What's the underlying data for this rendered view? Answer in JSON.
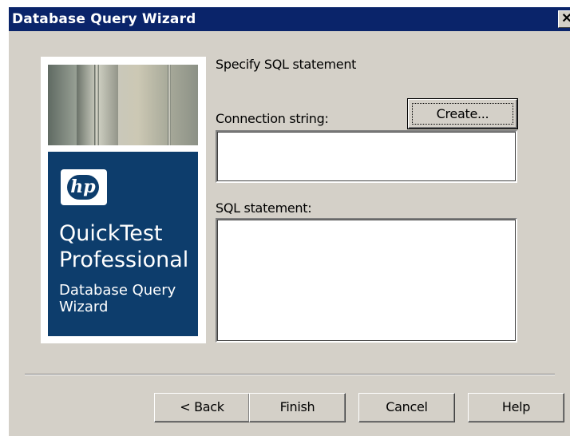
{
  "window": {
    "title": "Database Query Wizard",
    "close_glyph": "✕"
  },
  "side_panel": {
    "logo_text": "hp",
    "product_name": "QuickTest\nProfessional",
    "product_subtitle": "Database Query\nWizard"
  },
  "main": {
    "heading": "Specify SQL statement",
    "connection_label": "Connection string:",
    "connection_value": "",
    "create_button": "Create...",
    "sql_label": "SQL statement:",
    "sql_value": ""
  },
  "footer": {
    "back_button": "< Back",
    "finish_button": "Finish",
    "cancel_button": "Cancel",
    "help_button": "Help"
  },
  "colors": {
    "titlebar": "#0a246a",
    "dialog_face": "#d4d0c8",
    "brand_panel": "#0d3d6c"
  }
}
